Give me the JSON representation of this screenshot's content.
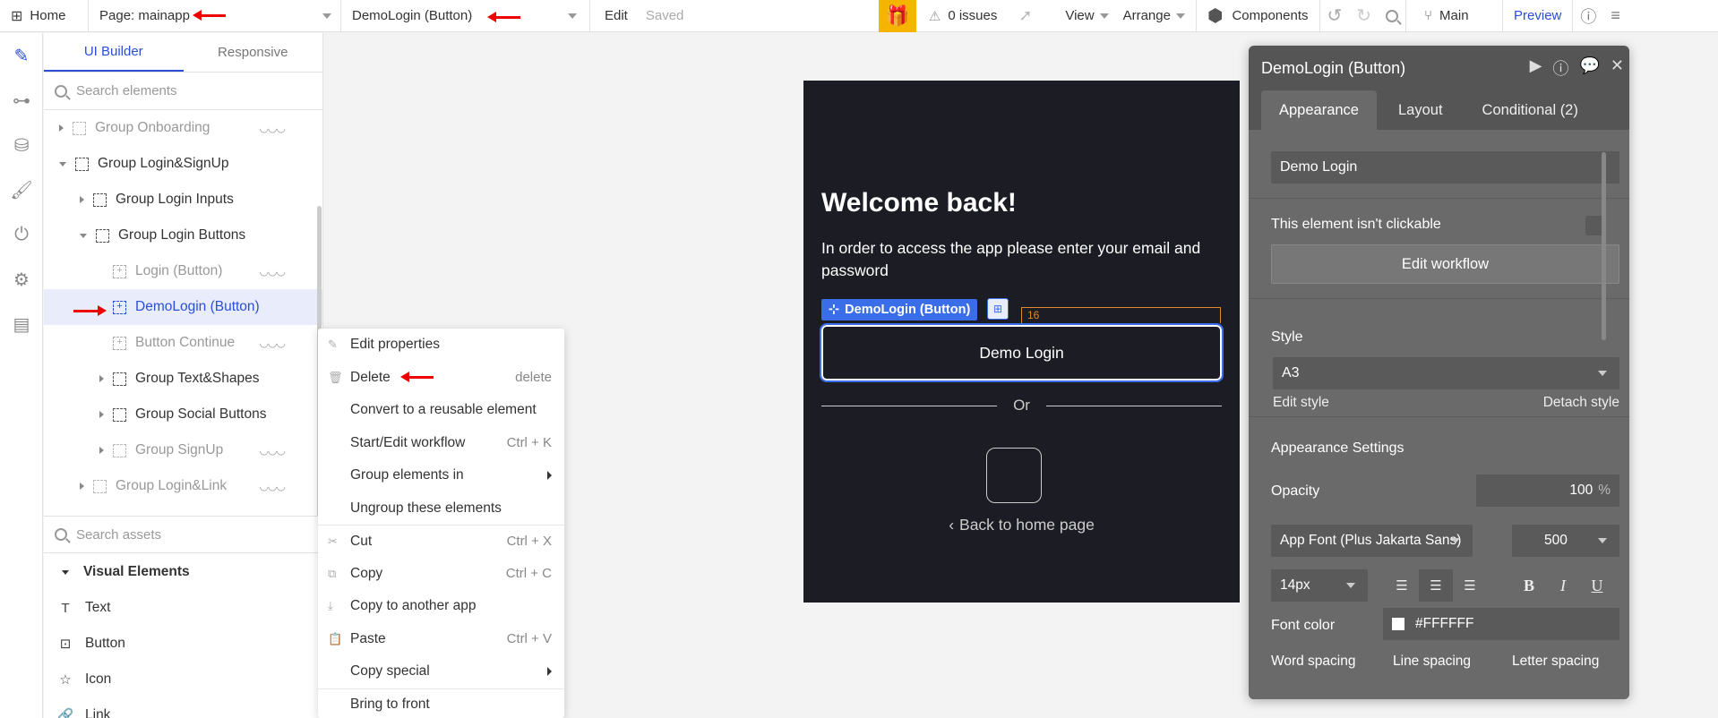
{
  "topbar": {
    "home_label": "Home",
    "page_label": "Page: mainapp",
    "element_label": "DemoLogin (Button)",
    "edit_label": "Edit",
    "saved_label": "Saved",
    "issues_label": "0 issues",
    "view_label": "View",
    "arrange_label": "Arrange",
    "components_label": "Components",
    "branch_label": "Main",
    "preview_label": "Preview"
  },
  "tree": {
    "tab_builder": "UI Builder",
    "tab_responsive": "Responsive",
    "search_placeholder": "Search elements",
    "items": [
      {
        "label": "Group Onboarding"
      },
      {
        "label": "Group Login&SignUp"
      },
      {
        "label": "Group Login Inputs"
      },
      {
        "label": "Group Login Buttons"
      },
      {
        "label": "Login (Button)"
      },
      {
        "label": "DemoLogin (Button)"
      },
      {
        "label": "Button Continue"
      },
      {
        "label": "Group Text&Shapes"
      },
      {
        "label": "Group Social Buttons"
      },
      {
        "label": "Group SignUp"
      },
      {
        "label": "Group Login&Link"
      }
    ],
    "assets_placeholder": "Search assets",
    "visual_header": "Visual Elements",
    "visual_items": [
      {
        "label": "Text"
      },
      {
        "label": "Button"
      },
      {
        "label": "Icon"
      },
      {
        "label": "Link"
      }
    ]
  },
  "context_menu": {
    "edit_properties": "Edit properties",
    "delete": "Delete",
    "delete_shortcut": "delete",
    "convert": "Convert to a reusable element",
    "workflow": "Start/Edit workflow",
    "workflow_shortcut": "Ctrl + K",
    "group_in": "Group elements in",
    "ungroup": "Ungroup these elements",
    "cut": "Cut",
    "cut_shortcut": "Ctrl + X",
    "copy": "Copy",
    "copy_shortcut": "Ctrl + C",
    "copy_app": "Copy to another app",
    "paste": "Paste",
    "paste_shortcut": "Ctrl + V",
    "copy_special": "Copy special",
    "bring_front": "Bring to front"
  },
  "canvas": {
    "welcome": "Welcome back!",
    "subtitle": "In order to access the app please enter your email and password",
    "selected_label": "DemoLogin (Button)",
    "spacing": "16",
    "demo_button": "Demo Login",
    "or": "Or",
    "back": "Back to home page"
  },
  "props": {
    "title": "DemoLogin (Button)",
    "tab_appearance": "Appearance",
    "tab_layout": "Layout",
    "tab_conditional": "Conditional (2)",
    "text_value": "Demo Login",
    "not_clickable": "This element isn't clickable",
    "edit_workflow": "Edit workflow",
    "style_label": "Style",
    "style_value": "A3",
    "edit_style": "Edit style",
    "detach_style": "Detach style",
    "appearance_settings": "Appearance Settings",
    "opacity_label": "Opacity",
    "opacity_value": "100",
    "opacity_unit": "%",
    "font_value": "App Font (Plus Jakarta Sans)",
    "weight_value": "500",
    "size_value": "14px",
    "font_color_label": "Font color",
    "font_color_value": "#FFFFFF",
    "word_spacing": "Word spacing",
    "line_spacing": "Line spacing",
    "letter_spacing": "Letter spacing"
  }
}
